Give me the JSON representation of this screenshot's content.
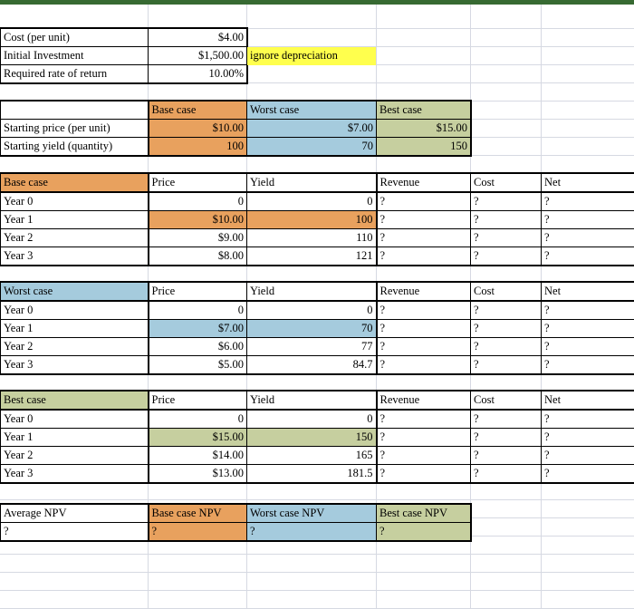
{
  "app": {
    "accent_color": "#376a32",
    "orange": "#e8a15e",
    "blue": "#a5cbdd",
    "green": "#c6cf9f",
    "yellow": "#ffff4d"
  },
  "assumptions": {
    "rows": [
      {
        "label": "Cost (per unit)",
        "value": "$4.00"
      },
      {
        "label": "Initial Investment",
        "value": "$1,500.00"
      },
      {
        "label": "Required rate of return",
        "value": "10.00%"
      }
    ],
    "note": "ignore depreciation"
  },
  "scenarios": {
    "header": {
      "blank": "",
      "base": "Base case",
      "worst": "Worst case",
      "best": "Best case"
    },
    "rows": [
      {
        "label": "Starting price (per unit)",
        "base": "$10.00",
        "worst": "$7.00",
        "best": "$15.00"
      },
      {
        "label": "Starting yield (quantity)",
        "base": "100",
        "worst": "70",
        "best": "150"
      }
    ]
  },
  "columns": {
    "price": "Price",
    "yield": "Yield",
    "revenue": "Revenue",
    "cost": "Cost",
    "net": "Net"
  },
  "base_case": {
    "title": "Base case",
    "rows": [
      {
        "label": "Year 0",
        "price": "0",
        "yield": "0",
        "revenue": "?",
        "cost": "?",
        "net": "?"
      },
      {
        "label": "Year 1",
        "price": "$10.00",
        "yield": "100",
        "revenue": "?",
        "cost": "?",
        "net": "?"
      },
      {
        "label": "Year 2",
        "price": "$9.00",
        "yield": "110",
        "revenue": "?",
        "cost": "?",
        "net": "?"
      },
      {
        "label": "Year 3",
        "price": "$8.00",
        "yield": "121",
        "revenue": "?",
        "cost": "?",
        "net": "?"
      }
    ]
  },
  "worst_case": {
    "title": "Worst case",
    "rows": [
      {
        "label": "Year 0",
        "price": "0",
        "yield": "0",
        "revenue": "?",
        "cost": "?",
        "net": "?"
      },
      {
        "label": "Year 1",
        "price": "$7.00",
        "yield": "70",
        "revenue": "?",
        "cost": "?",
        "net": "?"
      },
      {
        "label": "Year 2",
        "price": "$6.00",
        "yield": "77",
        "revenue": "?",
        "cost": "?",
        "net": "?"
      },
      {
        "label": "Year 3",
        "price": "$5.00",
        "yield": "84.7",
        "revenue": "?",
        "cost": "?",
        "net": "?"
      }
    ]
  },
  "best_case": {
    "title": "Best case",
    "rows": [
      {
        "label": "Year 0",
        "price": "0",
        "yield": "0",
        "revenue": "?",
        "cost": "?",
        "net": "?"
      },
      {
        "label": "Year 1",
        "price": "$15.00",
        "yield": "150",
        "revenue": "?",
        "cost": "?",
        "net": "?"
      },
      {
        "label": "Year 2",
        "price": "$14.00",
        "yield": "165",
        "revenue": "?",
        "cost": "?",
        "net": "?"
      },
      {
        "label": "Year 3",
        "price": "$13.00",
        "yield": "181.5",
        "revenue": "?",
        "cost": "?",
        "net": "?"
      }
    ]
  },
  "npv": {
    "header": {
      "average": "Average NPV",
      "base": "Base case NPV",
      "worst": "Worst case NPV",
      "best": "Best case NPV"
    },
    "values": {
      "average": "?",
      "base": "?",
      "worst": "?",
      "best": "?"
    }
  }
}
